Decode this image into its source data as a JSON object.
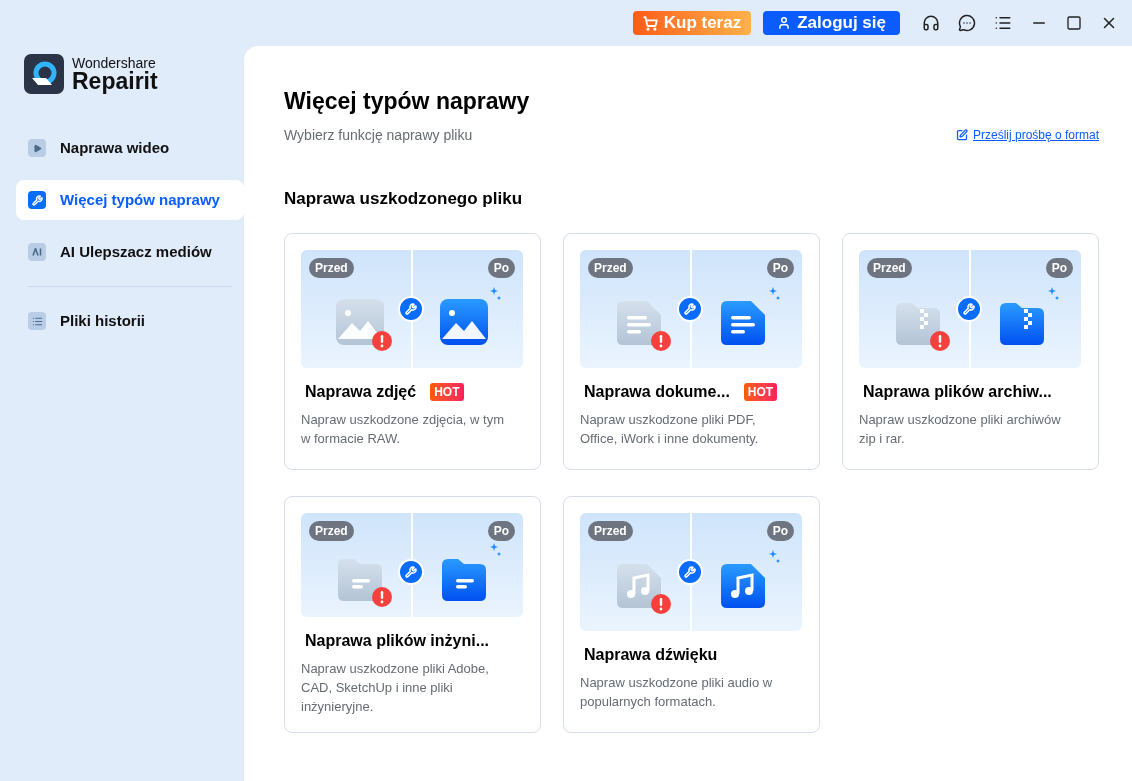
{
  "topbar": {
    "buy_button": "Kup teraz",
    "login_button": "Zaloguj się"
  },
  "logo": {
    "brand": "Wondershare",
    "product": "Repairit"
  },
  "sidebar": {
    "items": [
      {
        "label": "Naprawa wideo",
        "kind": "video",
        "selected": false
      },
      {
        "label": "Więcej typów naprawy",
        "kind": "wrench",
        "selected": true
      },
      {
        "label": "AI Ulepszacz mediów",
        "kind": "ai",
        "selected": false
      }
    ],
    "secondary_items": [
      {
        "label": "Pliki historii",
        "kind": "list",
        "selected": false
      }
    ]
  },
  "main": {
    "title": "Więcej typów naprawy",
    "subtitle": "Wybierz funkcję naprawy pliku",
    "request_link": "Prześlij prośbę o format",
    "section_title": "Naprawa uszkodzonego pliku",
    "cards": [
      {
        "kind": "image",
        "before": "Przed",
        "after": "Po",
        "title": "Naprawa zdjęć",
        "badge": "HOT",
        "description": "Napraw uszkodzone zdjęcia, w tym w formacie RAW."
      },
      {
        "kind": "document",
        "before": "Przed",
        "after": "Po",
        "title": "Naprawa dokume...",
        "badge": "HOT",
        "description": "Napraw uszkodzone pliki PDF, Office, iWork i inne dokumenty."
      },
      {
        "kind": "archive",
        "before": "Przed",
        "after": "Po",
        "title": "Naprawa plików archiw...",
        "description": "Napraw uszkodzone pliki archiwów zip i rar."
      },
      {
        "kind": "folder",
        "before": "Przed",
        "after": "Po",
        "title": "Naprawa plików inżyni...",
        "description": "Napraw uszkodzone pliki Adobe, CAD, SketchUp i inne pliki inżynieryjne."
      },
      {
        "kind": "audio",
        "before": "Przed",
        "after": "Po",
        "title": "Naprawa dźwięku",
        "description": "Napraw uszkodzone pliki audio w popularnych formatach."
      }
    ]
  }
}
